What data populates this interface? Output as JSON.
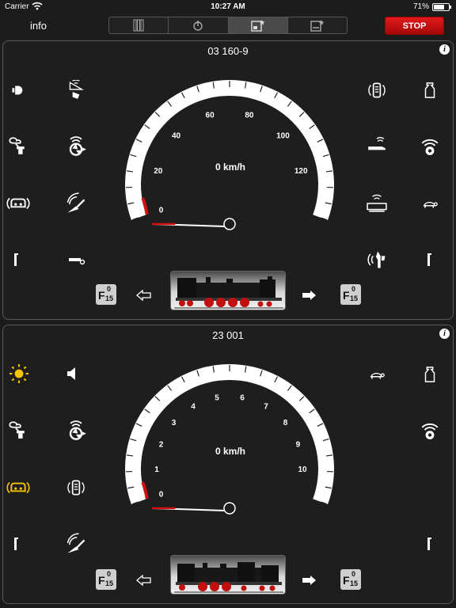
{
  "status_bar": {
    "carrier": "Carrier",
    "time": "10:27 AM",
    "battery": "71%",
    "battery_level": 0.71
  },
  "top_bar": {
    "info_label": "info",
    "stop_label": "STOP",
    "segments": [
      {
        "icon": "multi-controller-icon",
        "active": false
      },
      {
        "icon": "controller-icon",
        "active": false
      },
      {
        "icon": "keyboard-star-icon",
        "active": true
      },
      {
        "icon": "layout-star-icon",
        "active": false
      }
    ]
  },
  "locos": [
    {
      "name": "03 160-9",
      "speed_text": "0 km/h",
      "speed_value": 0,
      "max_speed": 140,
      "scale_labels": [
        "0",
        "20",
        "40",
        "60",
        "80",
        "100",
        "120"
      ],
      "f_button": {
        "letter": "F",
        "top": "0",
        "bottom": "15"
      },
      "functions_left": [
        "headlight-icon",
        "smoke-generator-icon",
        "whistle-horn-icon",
        "fan-icon",
        "sound-icon",
        "coal-shovel-icon",
        "cab-light-icon",
        "whistle-icon"
      ],
      "functions_right": [
        "brake-sound-icon",
        "uncoupler-icon",
        "wheel-sound-icon",
        "injector-icon",
        "station-announcement-icon",
        "turtle-icon",
        "steam-release-icon",
        "cab-light-icon"
      ]
    },
    {
      "name": "23 001",
      "speed_text": "0 km/h",
      "speed_value": 0,
      "max_speed": 11,
      "scale_labels": [
        "0",
        "1",
        "2",
        "3",
        "4",
        "5",
        "6",
        "7",
        "8",
        "9",
        "10"
      ],
      "f_button": {
        "letter": "F",
        "top": "0",
        "bottom": "15"
      },
      "functions_left": [
        "headlight-on-icon",
        "sound-icon",
        "smoke-generator-icon",
        "fan-icon",
        "whistle-horn-on-icon",
        "brake-sound-icon",
        "cab-light-icon",
        "coal-shovel-icon"
      ],
      "functions_right": [
        "turtle-icon",
        "uncoupler-icon",
        "wheel-sound-icon",
        "cab-light-icon"
      ]
    }
  ],
  "colors": {
    "accent_red": "#d50f0f",
    "active_yellow": "#f5c400",
    "icon_white": "#ffffff"
  }
}
